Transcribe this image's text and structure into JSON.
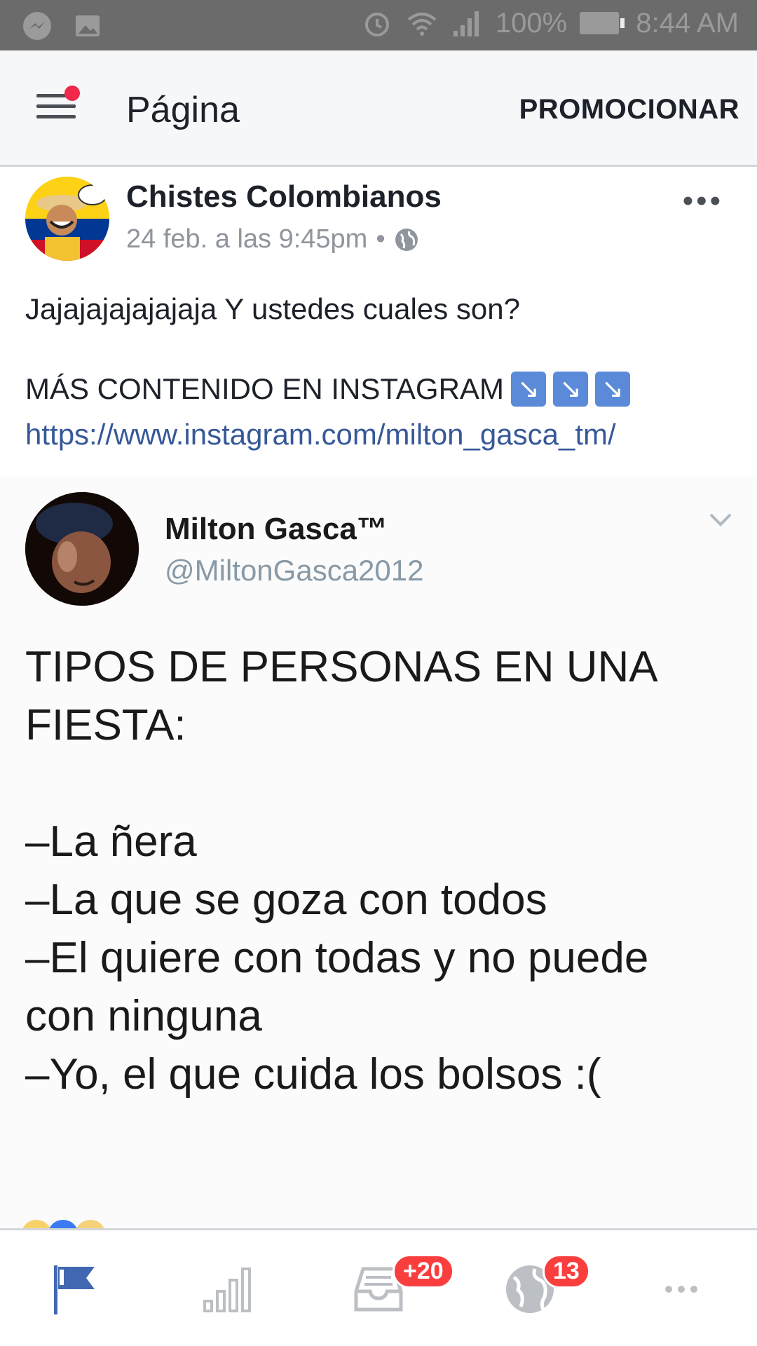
{
  "status_bar": {
    "battery": "100%",
    "time": "8:44 AM"
  },
  "header": {
    "title": "Página",
    "promote_label": "PROMOCIONAR"
  },
  "post": {
    "author": "Chistes Colombianos",
    "timestamp": "24 feb. a las 9:45pm",
    "separator": "•",
    "text": "Jajajajajajajaja Y ustedes cuales son?",
    "promo_text": "MÁS CONTENIDO EN INSTAGRAM",
    "promo_arrows": [
      "↘",
      "↘",
      "↘"
    ],
    "link": "https://www.instagram.com/milton_gasca_tm/"
  },
  "tweet": {
    "name": "Milton Gasca™",
    "handle": "@MiltonGasca2012",
    "lines": [
      "TIPOS DE PERSONAS EN UNA",
      "FIESTA:",
      "",
      "–La ñera",
      "–La que se goza con todos",
      "–El quiere con todas y no puede",
      "con ninguna",
      "–Yo, el que cuida los bolsos :("
    ]
  },
  "bottom_nav": {
    "items": [
      {
        "icon": "flag-icon",
        "active": true
      },
      {
        "icon": "insights-icon"
      },
      {
        "icon": "inbox-icon",
        "badge": "+20"
      },
      {
        "icon": "globe-icon",
        "badge": "13"
      },
      {
        "icon": "more-icon"
      }
    ],
    "active_color": "#4267b2",
    "inactive_color": "#bcc0c4"
  }
}
